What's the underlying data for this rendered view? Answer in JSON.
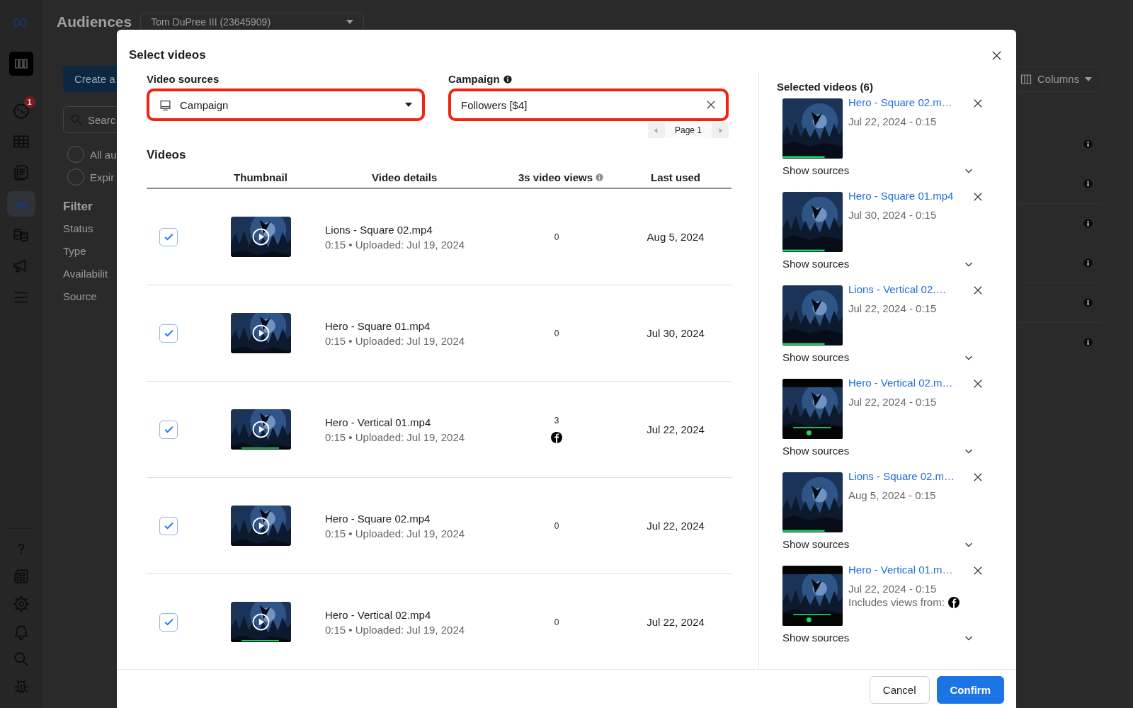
{
  "background_page": {
    "nav_top": [
      {
        "selected": false
      },
      {
        "selected": false
      },
      {
        "selected": false,
        "badge": "1"
      },
      {
        "selected": false
      },
      {
        "selected": false
      },
      {
        "selected": true
      },
      {
        "selected": false
      },
      {
        "selected": false
      },
      {
        "selected": false
      }
    ],
    "nav_bottom": [
      {
        "selected": false
      },
      {
        "selected": false
      },
      {
        "selected": false
      },
      {
        "selected": false
      },
      {
        "selected": false
      },
      {
        "selected": false
      }
    ],
    "title": "Audiences",
    "account_select": "Tom DuPree III (23645909)",
    "create_button": "Create a",
    "search_placeholder": "Searc",
    "radios": [
      {
        "label": "All au",
        "selected": false
      },
      {
        "label": "Expir",
        "selected": false
      }
    ],
    "filter_title": "Filter",
    "filters": [
      "Status",
      "Type",
      "Availabilit",
      "Source"
    ],
    "columns_button": "Columns"
  },
  "modal": {
    "title": "Select videos",
    "video_sources": {
      "label": "Video sources",
      "value": "Campaign",
      "highlighted": true
    },
    "campaign": {
      "label": "Campaign",
      "value": "Followers [$4]",
      "highlighted": true
    },
    "pager": "Page 1",
    "videos_title": "Videos",
    "columns": [
      "Thumbnail",
      "Video details",
      "3s video views",
      "Last used"
    ],
    "rows": [
      {
        "checked": true,
        "kind": "square",
        "name": "Lions - Square 02.mp4",
        "meta": "0:15 • Uploaded: Jul 19, 2024",
        "views": "0",
        "source_icon": false,
        "last_used": "Aug 5, 2024"
      },
      {
        "checked": true,
        "kind": "square",
        "name": "Hero - Square 01.mp4",
        "meta": "0:15 • Uploaded: Jul 19, 2024",
        "views": "0",
        "source_icon": false,
        "last_used": "Jul 30, 2024"
      },
      {
        "checked": true,
        "kind": "vertical",
        "name": "Hero - Vertical 01.mp4",
        "meta": "0:15 • Uploaded: Jul 19, 2024",
        "views": "3",
        "source_icon": true,
        "last_used": "Jul 22, 2024"
      },
      {
        "checked": true,
        "kind": "square",
        "name": "Hero - Square 02.mp4",
        "meta": "0:15 • Uploaded: Jul 19, 2024",
        "views": "0",
        "source_icon": false,
        "last_used": "Jul 22, 2024"
      },
      {
        "checked": true,
        "kind": "vertical",
        "name": "Hero - Vertical 02.mp4",
        "meta": "0:15 • Uploaded: Jul 19, 2024",
        "views": "0",
        "source_icon": false,
        "last_used": "Jul 22, 2024"
      }
    ],
    "selected_panel": {
      "title": "Selected videos (6)",
      "items": [
        {
          "kind": "square",
          "name": "Hero - Square 02.m…",
          "date": "Jul 22, 2024 - 0:15",
          "show_sources": "Show sources"
        },
        {
          "kind": "square",
          "name": "Hero - Square 01.mp4",
          "date": "Jul 30, 2024 - 0:15",
          "show_sources": "Show sources"
        },
        {
          "kind": "square",
          "name": "Lions - Vertical 02.…",
          "date": "Jul 22, 2024 - 0:15",
          "show_sources": "Show sources"
        },
        {
          "kind": "vertical",
          "name": "Hero - Vertical 02.m…",
          "date": "Jul 22, 2024 - 0:15",
          "show_sources": "Show sources"
        },
        {
          "kind": "square",
          "name": "Lions - Square 02.m…",
          "date": "Aug 5, 2024 - 0:15",
          "show_sources": "Show sources"
        },
        {
          "kind": "vertical",
          "name": "Hero - Vertical 01.m…",
          "date": "Jul 22, 2024 - 0:15",
          "views_note": "Includes views from:",
          "show_sources": "Show sources"
        }
      ]
    },
    "buttons": [
      {
        "label": "Cancel",
        "kind": "secondary"
      },
      {
        "label": "Confirm",
        "kind": "primary"
      }
    ]
  }
}
